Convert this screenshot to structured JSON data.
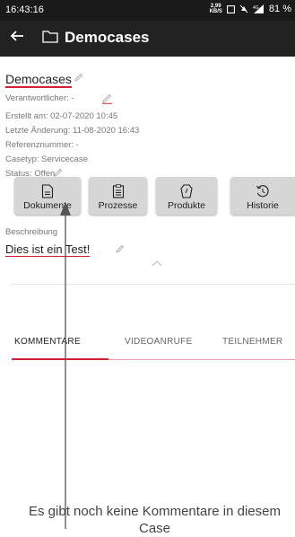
{
  "status_bar": {
    "time": "16:43:16",
    "net_speed_value": "2,99",
    "net_speed_unit": "KB/S",
    "signal_label": "4G",
    "battery": "81 %"
  },
  "app_bar": {
    "title": "Democases",
    "back_icon": "arrow-left-icon",
    "folder_icon": "folder-icon"
  },
  "case": {
    "title": "Democases",
    "responsible": "Verantwortlicher: -",
    "created": "Erstellt am: 02-07-2020  10:45",
    "modified": "Letzte Änderung: 11-08-2020  16:43",
    "reference": "Referenznummer: -",
    "type": "Casetyp: Servicecase",
    "status": "Status: Offen"
  },
  "buttons": [
    {
      "label": "Dokumente",
      "icon": "document-icon"
    },
    {
      "label": "Prozesse",
      "icon": "clipboard-list-icon"
    },
    {
      "label": "Produkte",
      "icon": "product-tag-icon"
    },
    {
      "label": "Historie",
      "icon": "history-icon"
    }
  ],
  "description": {
    "label": "Beschreibung",
    "text": "Dies ist ein Test!"
  },
  "tabs": [
    {
      "label": "KOMMENTARE",
      "active": true
    },
    {
      "label": "VIDEOANRUFE",
      "active": false
    },
    {
      "label": "TEILNEHMER",
      "active": false
    }
  ],
  "empty_state": "Es gibt noch keine Kommentare in diesem Case",
  "colors": {
    "accent": "#d22030",
    "app_bar": "#222222",
    "status_bar": "#1a1a1a",
    "button_bg": "#d6d6d6"
  }
}
